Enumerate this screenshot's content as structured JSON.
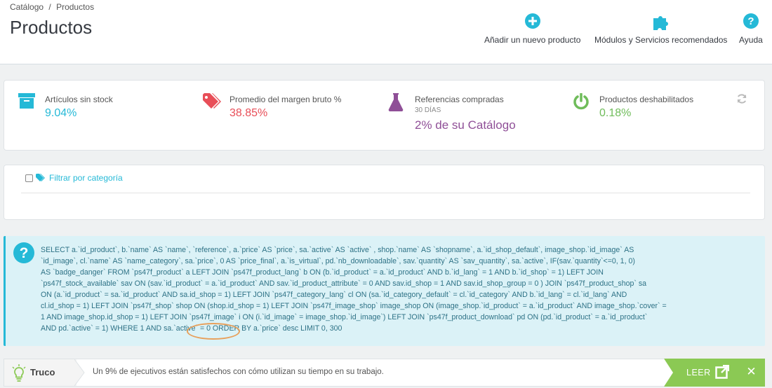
{
  "breadcrumb": {
    "item1": "Catálogo",
    "separator": "/",
    "item2": "Productos"
  },
  "page": {
    "title": "Productos"
  },
  "toolbar": {
    "add_product": "Añadir un nuevo producto",
    "modules": "Módulos y Servicios recomendados",
    "help": "Ayuda"
  },
  "kpis": {
    "out_of_stock": {
      "title": "Artículos sin stock",
      "value": "9.04%",
      "color": "#25b9d7"
    },
    "margin": {
      "title": "Promedio del margen bruto %",
      "value": "38.85%",
      "color": "#e84e58"
    },
    "purchased": {
      "title": "Referencias compradas",
      "subtitle": "30 DÍAS",
      "value": "2% de su Catálogo",
      "color": "#8f4f97"
    },
    "disabled": {
      "title": "Productos deshabilitados",
      "value": "0.18%",
      "color": "#6fbc5a"
    }
  },
  "filter": {
    "label": "Filtrar por categoría"
  },
  "sql": {
    "lines": [
      "SELECT a.`id_product`, b.`name` AS `name`, `reference`, a.`price` AS `price`, sa.`active` AS `active` , shop.`name` AS `shopname`, a.`id_shop_default`, image_shop.`id_image` AS",
      "`id_image`, cl.`name` AS `name_category`, sa.`price`, 0 AS `price_final`, a.`is_virtual`, pd.`nb_downloadable`, sav.`quantity` AS `sav_quantity`, sa.`active`, IF(sav.`quantity`<=0, 1, 0)",
      "AS `badge_danger` FROM `ps47f_product` a LEFT JOIN `ps47f_product_lang` b ON (b.`id_product` = a.`id_product` AND b.`id_lang` = 1 AND b.`id_shop` = 1) LEFT JOIN",
      "`ps47f_stock_available` sav ON (sav.`id_product` = a.`id_product` AND sav.`id_product_attribute` = 0 AND sav.id_shop = 1 AND sav.id_shop_group = 0 ) JOIN `ps47f_product_shop` sa",
      "ON (a.`id_product` = sa.`id_product` AND sa.id_shop = 1) LEFT JOIN `ps47f_category_lang` cl ON (sa.`id_category_default` = cl.`id_category` AND b.`id_lang` = cl.`id_lang` AND",
      "cl.id_shop = 1) LEFT JOIN `ps47f_shop` shop ON (shop.id_shop = 1) LEFT JOIN `ps47f_image_shop` image_shop ON (image_shop.`id_product` = a.`id_product` AND image_shop.`cover` =",
      "1 AND image_shop.id_shop = 1) LEFT JOIN `ps47f_image` i ON (i.`id_image` = image_shop.`id_image`) LEFT JOIN `ps47f_product_download` pd ON (pd.`id_product` = a.`id_product`",
      "AND pd.`active` = 1) WHERE 1 AND sa.`active` = 0 ORDER BY a.`price` desc LIMIT 0, 300"
    ]
  },
  "tip": {
    "label": "Truco",
    "text": "Un 9% de ejecutivos están satisfechos con cómo utilizan su tiempo en su trabajo.",
    "read_label": "LEER",
    "close_label": "✕"
  },
  "colors": {
    "accent": "#25b9d7",
    "success": "#8bc954",
    "highlight": "#e8a05b"
  }
}
